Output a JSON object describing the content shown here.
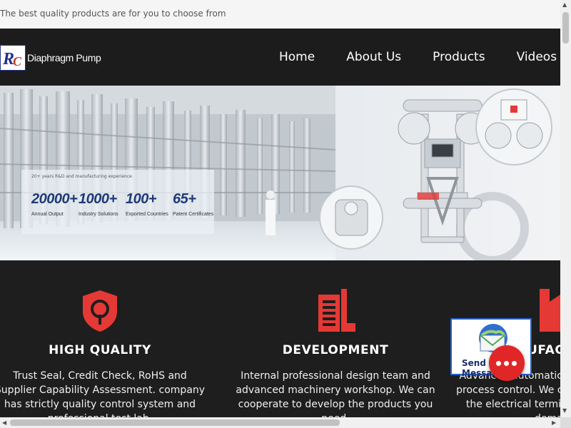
{
  "topbar": {
    "tagline": "The best quality products are for you to choose from"
  },
  "brand": {
    "logo_letters": "RC",
    "name": "Diaphragm Pump"
  },
  "nav": {
    "items": [
      {
        "label": "Home"
      },
      {
        "label": "About Us"
      },
      {
        "label": "Products"
      },
      {
        "label": "Videos"
      }
    ]
  },
  "hero": {
    "stats_heading": "20+ years R&D and manufacturing experience",
    "stats": [
      {
        "value": "20000+",
        "label": "Annual Output"
      },
      {
        "value": "1000+",
        "label": "Industry Solutions"
      },
      {
        "value": "100+",
        "label": "Exported Countries"
      },
      {
        "value": "65+",
        "label": "Patent Certificates"
      }
    ]
  },
  "features": [
    {
      "icon": "shield-icon",
      "title": "HIGH QUALITY",
      "desc": "Trust Seal, Credit Check, RoHS and Supplier Capability Assessment. company has strictly quality control system and professional test lab."
    },
    {
      "icon": "building-icon",
      "title": "DEVELOPMENT",
      "desc": "Internal professional design team and advanced machinery workshop. We can cooperate to develop the products you need."
    },
    {
      "icon": "factory-icon",
      "title": "MANUFACTURING",
      "desc": "Advanced automatic machines, strictly process control. We can manufacture all the electrical terminals beyond your demand."
    }
  ],
  "widgets": {
    "send_label": "Send Message"
  },
  "colors": {
    "accent": "#e02626",
    "nav_bg": "#1c1c1c",
    "features_bg": "#1e1e1e",
    "brand_blue": "#2a3a8c"
  }
}
